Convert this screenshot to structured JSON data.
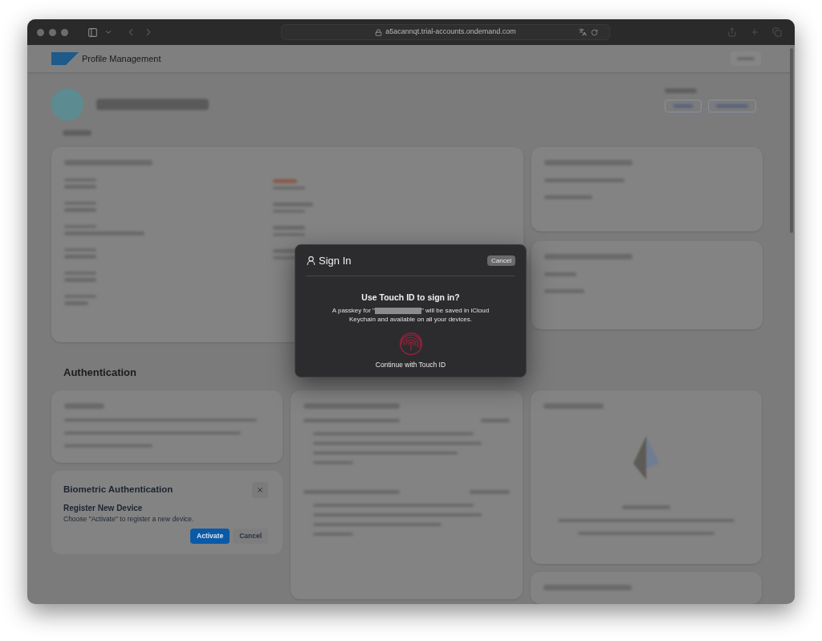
{
  "browser": {
    "url": "a5acannqt.trial-accounts.ondemand.com"
  },
  "app_header": {
    "title": "Profile Management"
  },
  "authentication_heading": "Authentication",
  "biometric_card": {
    "title": "Biometric Authentication",
    "subtitle": "Register New Device",
    "description": "Choose \"Activate\" to register a new device.",
    "buttons": [
      {
        "label": "Activate",
        "kind": "primary"
      },
      {
        "label": "Cancel",
        "kind": "secondary"
      }
    ]
  },
  "dialog": {
    "title": "Sign In",
    "cancel": "Cancel",
    "heading": "Use Touch ID to sign in?",
    "message_start": "A passkey for \"",
    "message_end": "\" will be saved in iCloud Keychain and available on all your devices.",
    "action": "Continue with Touch ID"
  }
}
